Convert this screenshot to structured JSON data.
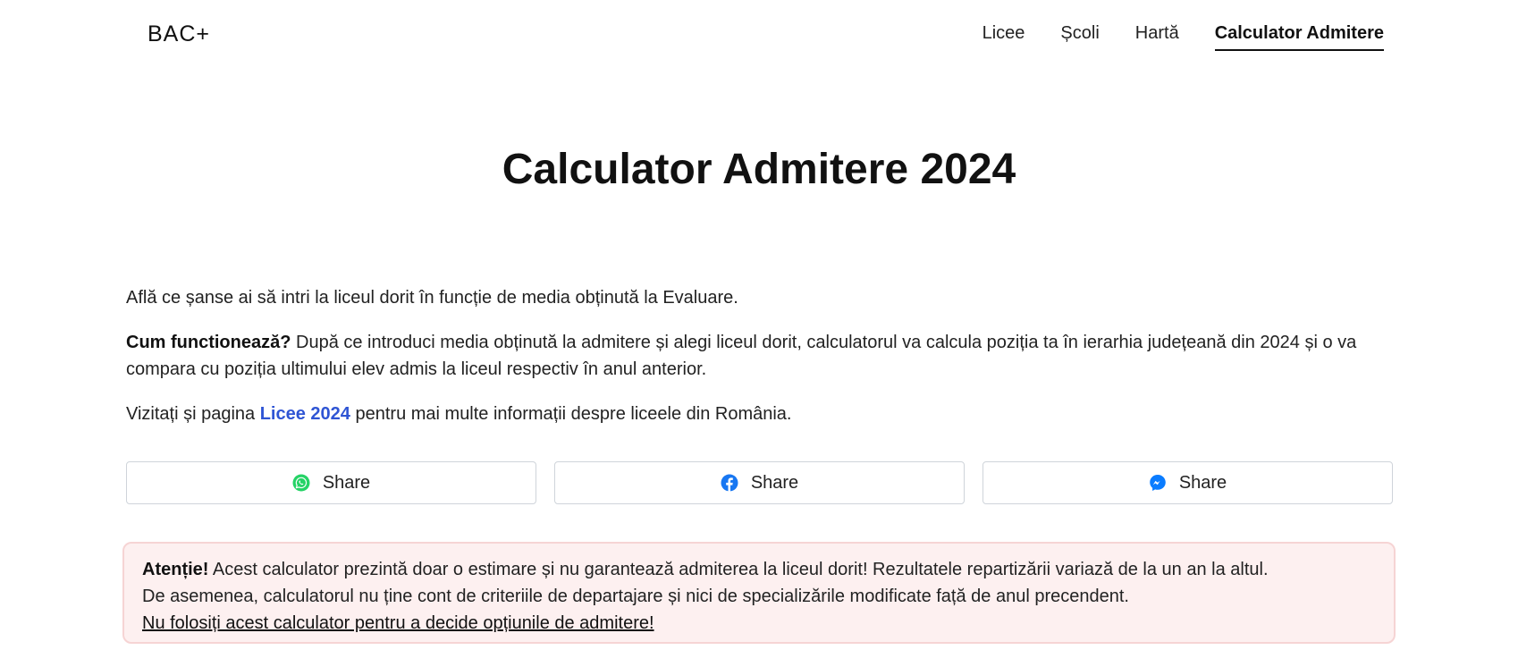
{
  "nav": {
    "logo": "BAC+",
    "links": [
      "Licee",
      "Școli",
      "Hartă",
      "Calculator Admitere"
    ]
  },
  "page": {
    "title": "Calculator Admitere 2024"
  },
  "intro": {
    "line1": "Află ce șanse ai să intri la liceul dorit în funcție de media obținută la Evaluare.",
    "how_label": "Cum functionează?",
    "how_text": " După ce introduci media obținută la admitere și alegi liceul dorit, calculatorul va calcula poziția ta în ierarhia județeană din 2024 și o va compara cu poziția ultimului elev admis la liceul respectiv în anul anterior.",
    "visit_prefix": "Vizitați și pagina ",
    "visit_link": "Licee 2024",
    "visit_suffix": " pentru mai multe informații despre liceele din România."
  },
  "share": {
    "buttons": [
      {
        "label": "Share",
        "icon": "whatsapp-icon",
        "color": "#25d366"
      },
      {
        "label": "Share",
        "icon": "facebook-icon",
        "color": "#1877f2"
      },
      {
        "label": "Share",
        "icon": "messenger-icon",
        "color": "#0a7cff"
      }
    ]
  },
  "warning": {
    "label": "Atenție!",
    "line1": " Acest calculator prezintă doar o estimare și nu garantează admiterea la liceul dorit! Rezultatele repartizării variază de la un an la altul.",
    "line2": "De asemenea, calculatorul nu ține cont de criteriile de departajare și nici de specializările modificate față de anul precendent.",
    "line3": "Nu folosiți acest calculator pentru a decide opțiunile de admitere!"
  },
  "colors": {
    "link": "#2f55d4",
    "warning_bg": "#fdf0f0",
    "warning_border": "#f6d4d4"
  }
}
